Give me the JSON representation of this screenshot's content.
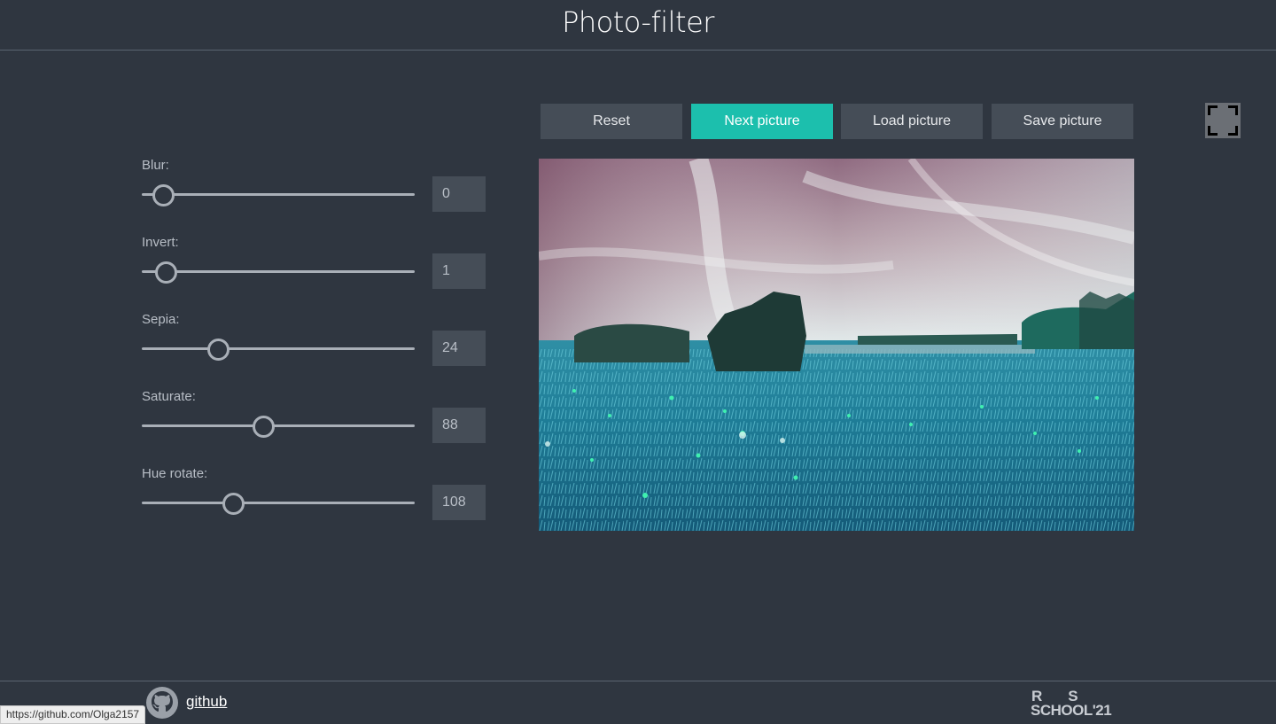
{
  "header": {
    "title": "Photo-filter"
  },
  "filters": [
    {
      "label": "Blur:",
      "value": "0",
      "level": 0.04
    },
    {
      "label": "Invert:",
      "value": "1",
      "level": 0.05
    },
    {
      "label": "Sepia:",
      "value": "24",
      "level": 0.26
    },
    {
      "label": "Saturate:",
      "value": "88",
      "level": 0.44
    },
    {
      "label": "Hue rotate:",
      "value": "108",
      "level": 0.32
    }
  ],
  "toolbar": {
    "reset_label": "Reset",
    "next_label": "Next picture",
    "load_label": "Load picture",
    "save_label": "Save picture"
  },
  "icons": {
    "fullscreen": "fullscreen-icon",
    "github": "github-icon"
  },
  "colors": {
    "background": "#2f3640",
    "accent": "#1cbfad",
    "panel": "#454d57"
  },
  "footer": {
    "github_label": "github",
    "logo_line1": "RS",
    "logo_line2": "SCHOOL'21"
  },
  "status_bar": {
    "url": "https://github.com/Olga2157"
  }
}
